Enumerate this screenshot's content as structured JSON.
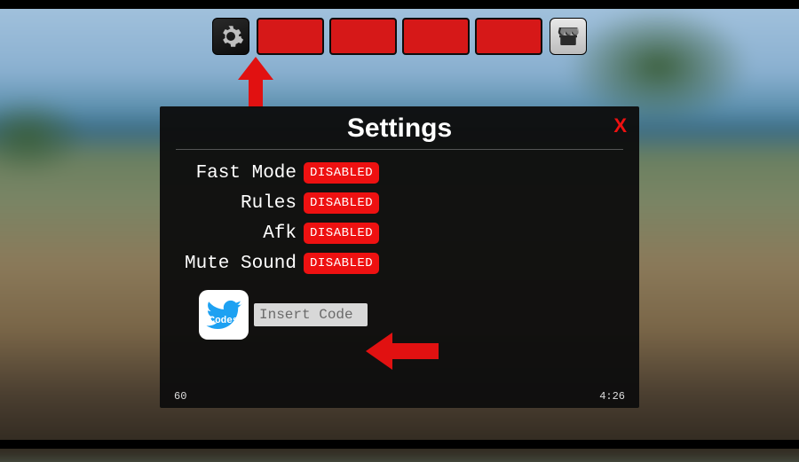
{
  "hud": {
    "slot_count": 4
  },
  "arrows": {
    "settings_pointer": "arrow-up",
    "code_pointer": "arrow-left"
  },
  "modal": {
    "title": "Settings",
    "close_label": "X",
    "rows": [
      {
        "label": "Fast Mode",
        "state": "DISABLED"
      },
      {
        "label": "Rules",
        "state": "DISABLED"
      },
      {
        "label": "Afk",
        "state": "DISABLED"
      },
      {
        "label": "Mute Sound",
        "state": "DISABLED"
      }
    ],
    "codes_label": "Codes",
    "code_placeholder": "Insert Code",
    "footer_left": "60",
    "footer_right": "4:26"
  },
  "colors": {
    "accent_red": "#e11111",
    "modal_bg": "#0e0e0e"
  }
}
